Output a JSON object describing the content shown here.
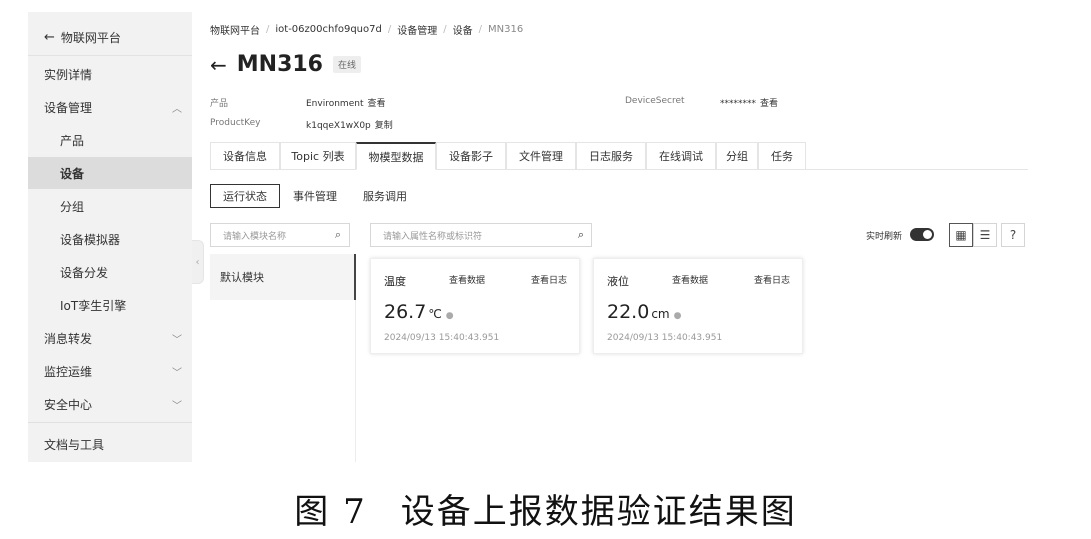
{
  "sidebar": {
    "back_label": "物联网平台",
    "items": [
      {
        "label": "实例详情"
      },
      {
        "label": "设备管理"
      },
      {
        "label": "产品"
      },
      {
        "label": "设备"
      },
      {
        "label": "分组"
      },
      {
        "label": "设备模拟器"
      },
      {
        "label": "设备分发"
      },
      {
        "label": "IoT孪生引擎"
      },
      {
        "label": "消息转发"
      },
      {
        "label": "监控运维"
      },
      {
        "label": "安全中心"
      },
      {
        "label": "文档与工具"
      }
    ],
    "active_item": "设备"
  },
  "breadcrumb": [
    "物联网平台",
    "iot-06z00chfo9quo7d",
    "设备管理",
    "设备",
    "MN316"
  ],
  "device": {
    "name": "MN316",
    "status": "在线",
    "product_label": "产品",
    "product_value": "Environment",
    "product_link": "查看",
    "productkey_label": "ProductKey",
    "productkey_value": "k1qqeX1wX0p",
    "productkey_link": "复制",
    "secret_label": "DeviceSecret",
    "secret_value": "********",
    "secret_link": "查看"
  },
  "tabs": [
    "设备信息",
    "Topic 列表",
    "物模型数据",
    "设备影子",
    "文件管理",
    "日志服务",
    "在线调试",
    "分组",
    "任务"
  ],
  "active_tab": "物模型数据",
  "subtabs": [
    "运行状态",
    "事件管理",
    "服务调用"
  ],
  "active_subtab": "运行状态",
  "module_search_placeholder": "请输入模块名称",
  "modules": [
    "默认模块"
  ],
  "property_search_placeholder": "请输入属性名称或标识符",
  "realtime_refresh_label": "实时刷新",
  "realtime_refresh_on": true,
  "help_label": "?",
  "cards": [
    {
      "name": "温度",
      "view_data": "查看数据",
      "view_log": "查看日志",
      "value": "26.7",
      "unit": "℃",
      "time": "2024/09/13 15:40:43.951"
    },
    {
      "name": "液位",
      "view_data": "查看数据",
      "view_log": "查看日志",
      "value": "22.0",
      "unit": "cm",
      "time": "2024/09/13 15:40:43.951"
    }
  ],
  "caption": {
    "number": "图 7",
    "text": "设备上报数据验证结果图"
  }
}
